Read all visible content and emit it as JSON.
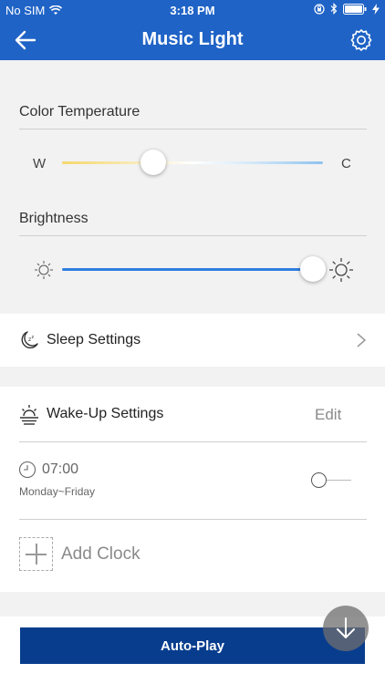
{
  "status_bar": {
    "carrier": "No SIM",
    "time": "3:18 PM"
  },
  "nav": {
    "title": "Music Light",
    "back_icon": "arrow-left-icon",
    "settings_icon": "gear-icon"
  },
  "color_temperature": {
    "label": "Color Temperature",
    "min_label": "W",
    "max_label": "C",
    "value_fraction": 0.35
  },
  "brightness": {
    "label": "Brightness",
    "min_icon": "sun-small-icon",
    "max_icon": "sun-large-icon",
    "value_fraction": 0.96
  },
  "sleep": {
    "label": "Sleep Settings",
    "icon": "moon-sleep-icon"
  },
  "wakeup": {
    "label": "Wake-Up Settings",
    "edit_label": "Edit",
    "icon": "sunrise-icon",
    "alarm": {
      "time": "07:00",
      "days": "Monday~Friday",
      "enabled": false
    },
    "add_label": "Add Clock"
  },
  "footer": {
    "autoplay_label": "Auto-Play"
  },
  "colors": {
    "brand_blue": "#1f63c6",
    "button_blue": "#083d8e",
    "slider_blue": "#2f7ddf",
    "warm_yellow": "#f5d76a"
  }
}
